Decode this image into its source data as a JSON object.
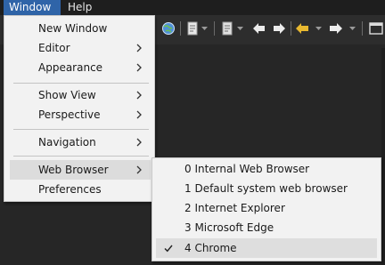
{
  "menubar": {
    "items": [
      {
        "label": "Window",
        "active": true
      },
      {
        "label": "Help",
        "active": false
      }
    ]
  },
  "toolbar": {
    "icons": [
      "globe-icon",
      "document-icon",
      "back-icon",
      "forward-icon",
      "previous-edit-icon",
      "next-icon",
      "maximize-icon"
    ]
  },
  "window_menu": {
    "items": [
      {
        "label": "New Window",
        "submenu": false
      },
      {
        "label": "Editor",
        "submenu": true
      },
      {
        "label": "Appearance",
        "submenu": true
      },
      {
        "label": "Show View",
        "submenu": true
      },
      {
        "label": "Perspective",
        "submenu": true
      },
      {
        "label": "Navigation",
        "submenu": true
      },
      {
        "label": "Web Browser",
        "submenu": true,
        "highlighted": true
      },
      {
        "label": "Preferences",
        "submenu": false
      }
    ]
  },
  "web_browser_submenu": {
    "items": [
      {
        "label": "0 Internal Web Browser",
        "checked": false
      },
      {
        "label": "1 Default system web browser",
        "checked": false
      },
      {
        "label": "2 Internet Explorer",
        "checked": false
      },
      {
        "label": "3 Microsoft Edge",
        "checked": false
      },
      {
        "label": "4 Chrome",
        "checked": true
      }
    ]
  },
  "colors": {
    "menubar_active": "#2f64a8",
    "menu_background": "#f2f2f2",
    "toolbar_background": "#2d2d2d",
    "yellow_arrow": "#e8b830"
  }
}
